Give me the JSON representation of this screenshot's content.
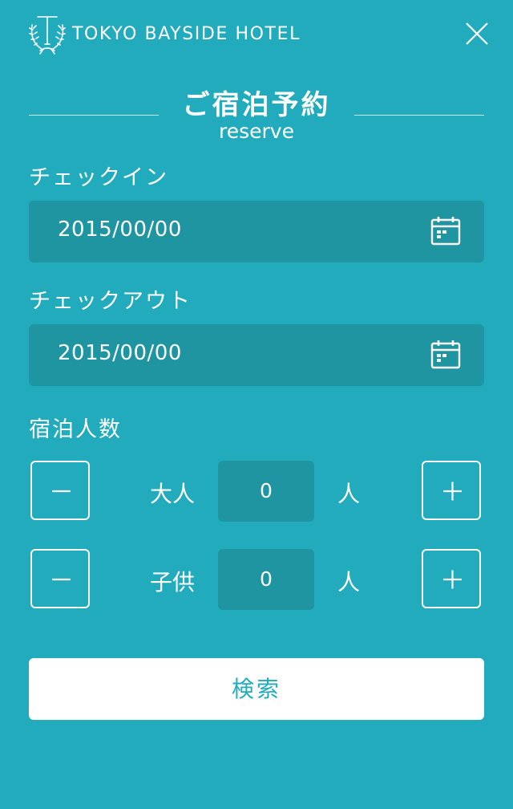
{
  "header": {
    "brand": "TOKYO BAYSIDE HOTEL",
    "logo_icon": "laurel-t-monogram-icon",
    "close_icon": "close-icon"
  },
  "title": {
    "main": "ご宿泊予約",
    "sub": "reserve"
  },
  "checkin": {
    "label": "チェックイン",
    "value": "2015/00/00",
    "icon": "calendar-icon"
  },
  "checkout": {
    "label": "チェックアウト",
    "value": "2015/00/00",
    "icon": "calendar-icon"
  },
  "guests": {
    "label": "宿泊人数",
    "adults": {
      "label": "大人",
      "count": "0",
      "unit": "人"
    },
    "children": {
      "label": "子供",
      "count": "0",
      "unit": "人"
    },
    "minus_icon": "minus-icon",
    "plus_icon": "plus-icon"
  },
  "search": {
    "label": "検索"
  },
  "colors": {
    "background": "#22abbc",
    "field": "#1f95a1",
    "text": "#ffffff",
    "button": "#ffffff"
  }
}
